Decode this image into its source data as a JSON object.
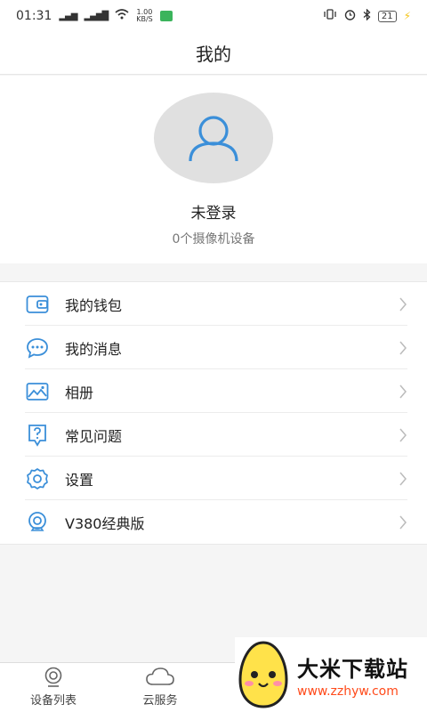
{
  "status_bar": {
    "time": "01:31",
    "speed": "1.00\nKB/S",
    "battery": "21"
  },
  "header": {
    "title": "我的"
  },
  "profile": {
    "username": "未登录",
    "device_count": "0个摄像机设备"
  },
  "menu": {
    "items": [
      {
        "label": "我的钱包",
        "icon": "wallet-icon"
      },
      {
        "label": "我的消息",
        "icon": "message-icon"
      },
      {
        "label": "相册",
        "icon": "album-icon"
      },
      {
        "label": "常见问题",
        "icon": "faq-icon"
      },
      {
        "label": "设置",
        "icon": "settings-gear-icon"
      },
      {
        "label": "V380经典版",
        "icon": "camera-icon"
      }
    ]
  },
  "tabbar": {
    "tabs": [
      {
        "label": "设备列表",
        "icon": "camera-icon"
      },
      {
        "label": "云服务",
        "icon": "cloud-icon"
      }
    ]
  },
  "watermark": {
    "title": "大米下载站",
    "url": "www.zzhyw.com"
  },
  "colors": {
    "accent": "#3b8fd9",
    "watermark_url": "#ff4a1a"
  }
}
